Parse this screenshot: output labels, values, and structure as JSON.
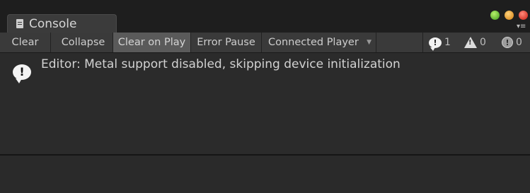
{
  "window": {
    "tab_label": "Console",
    "tab_icon": "console-doc-icon",
    "controls": [
      "maximize-button",
      "minimize-button",
      "close-button"
    ],
    "menu_icon": "▾≡"
  },
  "toolbar": {
    "clear_label": "Clear",
    "collapse_label": "Collapse",
    "clear_on_play_label": "Clear on Play",
    "error_pause_label": "Error Pause",
    "connected_player_label": "Connected Player",
    "connected_player_arrow": "▼",
    "counters": {
      "errors": 1,
      "warnings": 0,
      "messages": 0
    }
  },
  "log": {
    "entries": [
      {
        "type": "info",
        "icon": "message-bubble-icon",
        "text": "Editor: Metal support disabled, skipping device initialization"
      }
    ]
  },
  "colors": {
    "background": "#2a2a2a",
    "toolbar": "#3a3a3a",
    "active_toggle": "#5a5a5a",
    "text": "#d2d2d2"
  }
}
